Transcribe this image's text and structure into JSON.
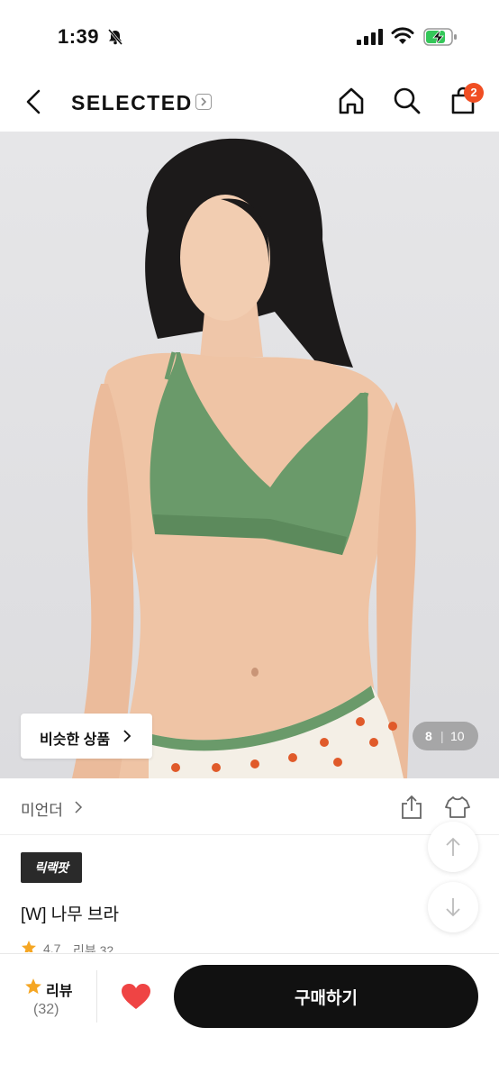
{
  "status_bar": {
    "time": "1:39"
  },
  "header": {
    "brand": "SELECTED",
    "cart_count": "2"
  },
  "gallery": {
    "similar_label": "비슷한 상품",
    "current": "8",
    "separator": "|",
    "total": "10"
  },
  "product": {
    "brand_name": "미언더",
    "tag": "릭랙팟",
    "name": "[W] 나무 브라",
    "rating": "4.7",
    "review_label": "리뷰 32"
  },
  "bottom_bar": {
    "review_label": "리뷰",
    "review_count": "(32)",
    "buy_label": "구매하기"
  },
  "colors": {
    "accent": "#f04e23",
    "heart": "#ef4444",
    "star": "#f5a623",
    "buy_button": "#111111",
    "garment": "#6a9a6a"
  }
}
